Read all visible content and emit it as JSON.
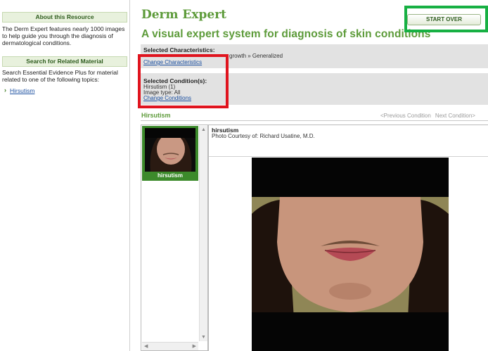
{
  "sidebar": {
    "about_heading": "About this Resource",
    "about_text": "The Derm Expert features nearly 1000 images to help guide you through the diagnosis of dermatological conditions.",
    "search_heading": "Search for Related Material",
    "search_text": "Search Essential Evidence Plus for material related to one of the following topics:",
    "topics": [
      {
        "label": "Hirsutism"
      }
    ]
  },
  "header": {
    "title": "Derm Expert",
    "subtitle": "A visual expert system for diagnosis of skin conditions",
    "start_over_label": "START OVER"
  },
  "characteristics": {
    "heading": "Selected Characteristics:",
    "path": "growth » Generalized",
    "change_link": "Change Characteristics"
  },
  "conditions": {
    "heading": "Selected Condition(s):",
    "selected": "Hirsutism (1)",
    "image_type": "Image type: All",
    "change_link": "Change Conditions"
  },
  "condition_bar": {
    "title": "Hirsutism",
    "prev_label": "<Previous Condition",
    "next_label": "Next Condition>"
  },
  "thumbnails": [
    {
      "label": "hirsutism"
    }
  ],
  "viewer": {
    "title": "hirsutism",
    "credit": "Photo Courtesy of: Richard Usatine, M.D."
  },
  "colors": {
    "brand_green": "#5d9b3a",
    "link_blue": "#1a4fa0",
    "panel_grey": "#e2e2e2",
    "annotation_green": "#17b043",
    "annotation_red": "#e0141e"
  },
  "icons": {
    "topic_bullet": "chevron-right-icon",
    "scroll_up": "triangle-up-icon",
    "scroll_down": "triangle-down-icon",
    "scroll_left": "triangle-left-icon",
    "scroll_right": "triangle-right-icon"
  }
}
